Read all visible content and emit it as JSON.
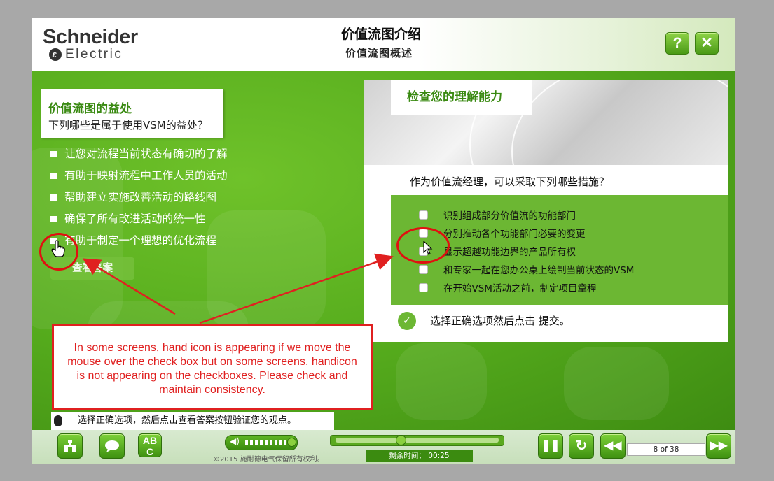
{
  "header": {
    "logo_line1": "Schneider",
    "logo_line2": "Electric",
    "title": "价值流图介绍",
    "subtitle": "价值流图概述",
    "help_label": "?",
    "close_label": "✕"
  },
  "left": {
    "card_title": "价值流图的益处",
    "card_question": "下列哪些是属于使用VSM的益处？",
    "items": [
      "让您对流程当前状态有确切的了解",
      "有助于映射流程中工作人员的活动",
      "帮助建立实施改善活动的路线图",
      "确保了所有改进活动的统一性",
      "有助于制定一个理想的优化流程"
    ],
    "check_answer_label": "查看答案",
    "hint_text": "选择正确选项，然后点击查看答案按钮验证您的观点。"
  },
  "right": {
    "title": "检查您的理解能力",
    "question": "作为价值流经理，可以采取下列哪些措施？",
    "options": [
      "识别组成部分价值流的功能部门",
      "分别推动各个功能部门必要的变更",
      "显示超越功能边界的产品所有权",
      "和专家一起在您办公桌上绘制当前状态的VSM",
      "在开始VSM活动之前，制定项目章程"
    ],
    "hint_text": "选择正确选项然后点击 提交。"
  },
  "annotation": {
    "text": "In some screens, hand icon is appearing if we move the mouse over the check box but on some screens, handicon is not appearing on the checkboxes. Please check and maintain consistency.",
    "color": "#e02020"
  },
  "footer": {
    "copyright": "©2015 施耐德电气保留所有权利。",
    "time_label": "剩余时间：",
    "time_value": "00:25",
    "page_indicator": "8 of 38",
    "abc_label": "AB C",
    "volume_level": 0.85,
    "progress": 0.41
  },
  "colors": {
    "accent_green": "#56ac1d",
    "title_green": "#3a8a12",
    "annotation_red": "#e02020"
  }
}
